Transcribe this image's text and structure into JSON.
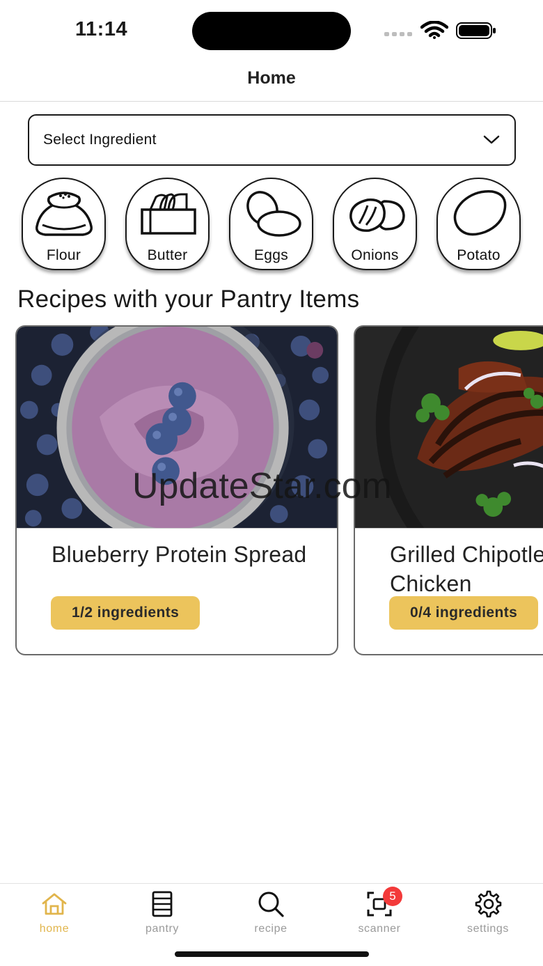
{
  "status_bar": {
    "time": "11:14"
  },
  "header": {
    "title": "Home"
  },
  "ingredient_select": {
    "placeholder": "Select Ingredient",
    "icon": "chevron-down-icon"
  },
  "ingredients": [
    {
      "label": "Flour",
      "icon": "flour-sack-icon"
    },
    {
      "label": "Butter",
      "icon": "butter-icon"
    },
    {
      "label": "Eggs",
      "icon": "eggs-icon"
    },
    {
      "label": "Onions",
      "icon": "onion-icon"
    },
    {
      "label": "Potato",
      "icon": "potato-icon"
    }
  ],
  "recipes_section": {
    "title": "Recipes with your Pantry Items"
  },
  "recipes": [
    {
      "title": "Blueberry Protein Spread",
      "ingredients_badge": "1/2 ingredients"
    },
    {
      "title": "Grilled Chipotle Cola BBQ Chicken",
      "ingredients_badge": "0/4 ingredients"
    }
  ],
  "watermark": "UpdateStar.com",
  "tabbar": {
    "items": [
      {
        "label": "home",
        "icon": "home-icon",
        "active": true
      },
      {
        "label": "pantry",
        "icon": "pantry-icon",
        "active": false
      },
      {
        "label": "recipe",
        "icon": "search-icon",
        "active": false
      },
      {
        "label": "scanner",
        "icon": "scanner-icon",
        "active": false,
        "badge": "5"
      },
      {
        "label": "settings",
        "icon": "gear-icon",
        "active": false
      }
    ]
  },
  "colors": {
    "accent": "#E1B54C",
    "badge_bg": "#ECC45C",
    "notification": "#F33A3A"
  }
}
